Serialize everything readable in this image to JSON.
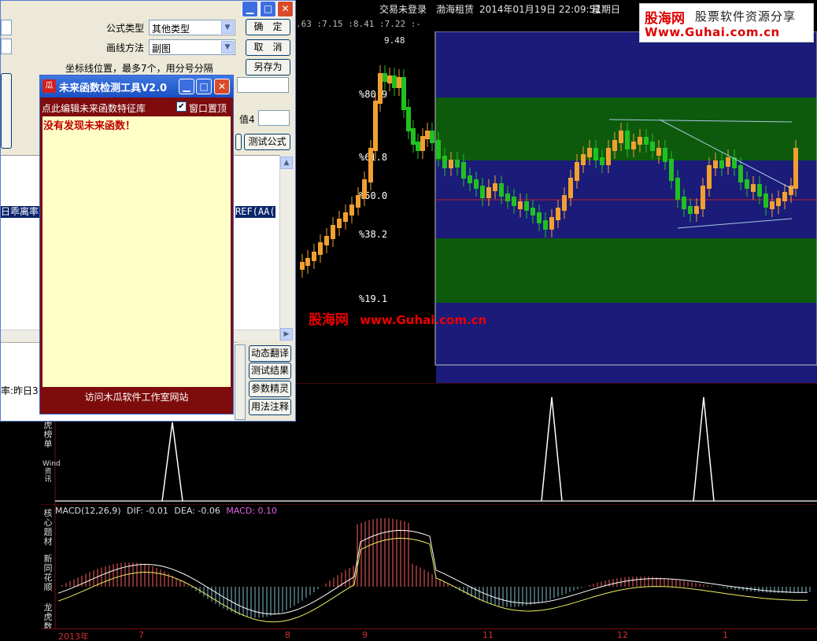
{
  "status_bar": {
    "login": "交易未登录",
    "stock": "渤海租赁",
    "datetime": "2014年01月19日 22:09:51",
    "weekday": "星期日"
  },
  "readout": {
    "values": ".63 :7.15 :8.41 :7.22 :-",
    "high_label": "9.48"
  },
  "banner": {
    "logo": "股海网",
    "slogan": "股票软件资源分享",
    "url": "Www.Guhai.com.cn"
  },
  "fib_levels": [
    "%80.9",
    "%61.8",
    "%50.0",
    "%38.2",
    "%19.1"
  ],
  "watermark": {
    "name": "股海网",
    "url": "www.Guhai.com.cn"
  },
  "left_labels": {
    "l1": "虎榜单",
    "l2": "Wind资讯",
    "l3": "核心题材",
    "l4": "新同花顺",
    "l5": "龙虎数据"
  },
  "macd": {
    "name": "MACD(12,26,9)",
    "dif": "DIF: -0.01",
    "dea": "DEA: -0.06",
    "macd": "MACD: 0.10"
  },
  "time_axis": [
    "2013年",
    "7",
    "8",
    "9",
    "11",
    "12",
    "1"
  ],
  "editor": {
    "formula_type_label": "公式类型",
    "formula_type_value": "其他类型",
    "draw_method_label": "画线方法",
    "draw_method_value": "副图",
    "coords_hint": "坐标线位置，最多7个，用分号分隔",
    "value4_label": "值4",
    "ok": "确　定",
    "cancel": "取　消",
    "save_as": "另存为",
    "test_formula": "测试公式",
    "dynamic_translate": "动态翻译",
    "test_result": "测试结果",
    "param_wizard": "参数精灵",
    "usage_note": "用法注释",
    "code_left": "日乖离率",
    "code_right": "REF(AA(",
    "lower_text": "率:昨日3"
  },
  "detector": {
    "title": "未来函数检测工具V2.0",
    "icon": "瓜",
    "edit_link": "点此编辑未来函数特征库",
    "topmost_label": "窗口置顶",
    "topmost_checked": true,
    "result": "没有发现未来函数！",
    "footer_link": "访问木瓜软件工作室网站"
  },
  "chart_data": [
    {
      "type": "candlestick",
      "title": "",
      "fib_retracement_levels": [
        80.9,
        61.8,
        50.0,
        38.2,
        19.1
      ],
      "annotated_high": 9.48
    },
    {
      "type": "line",
      "title": "",
      "series": [
        {
          "values": [
            0,
            0,
            1,
            0,
            0,
            0,
            1,
            0,
            1,
            0
          ]
        }
      ]
    },
    {
      "type": "bar",
      "title": "MACD(12,26,9)",
      "dif": -0.01,
      "dea": -0.06,
      "macd": 0.1
    }
  ],
  "colors": {
    "up": "#f0a030",
    "down": "#20c020",
    "chart_bg": "#1b1b7a",
    "band_green": "#0d5a0d",
    "fib_text": "#ffffff",
    "macd_pos": "#ff6060",
    "macd_neg": "#80c0d0"
  }
}
